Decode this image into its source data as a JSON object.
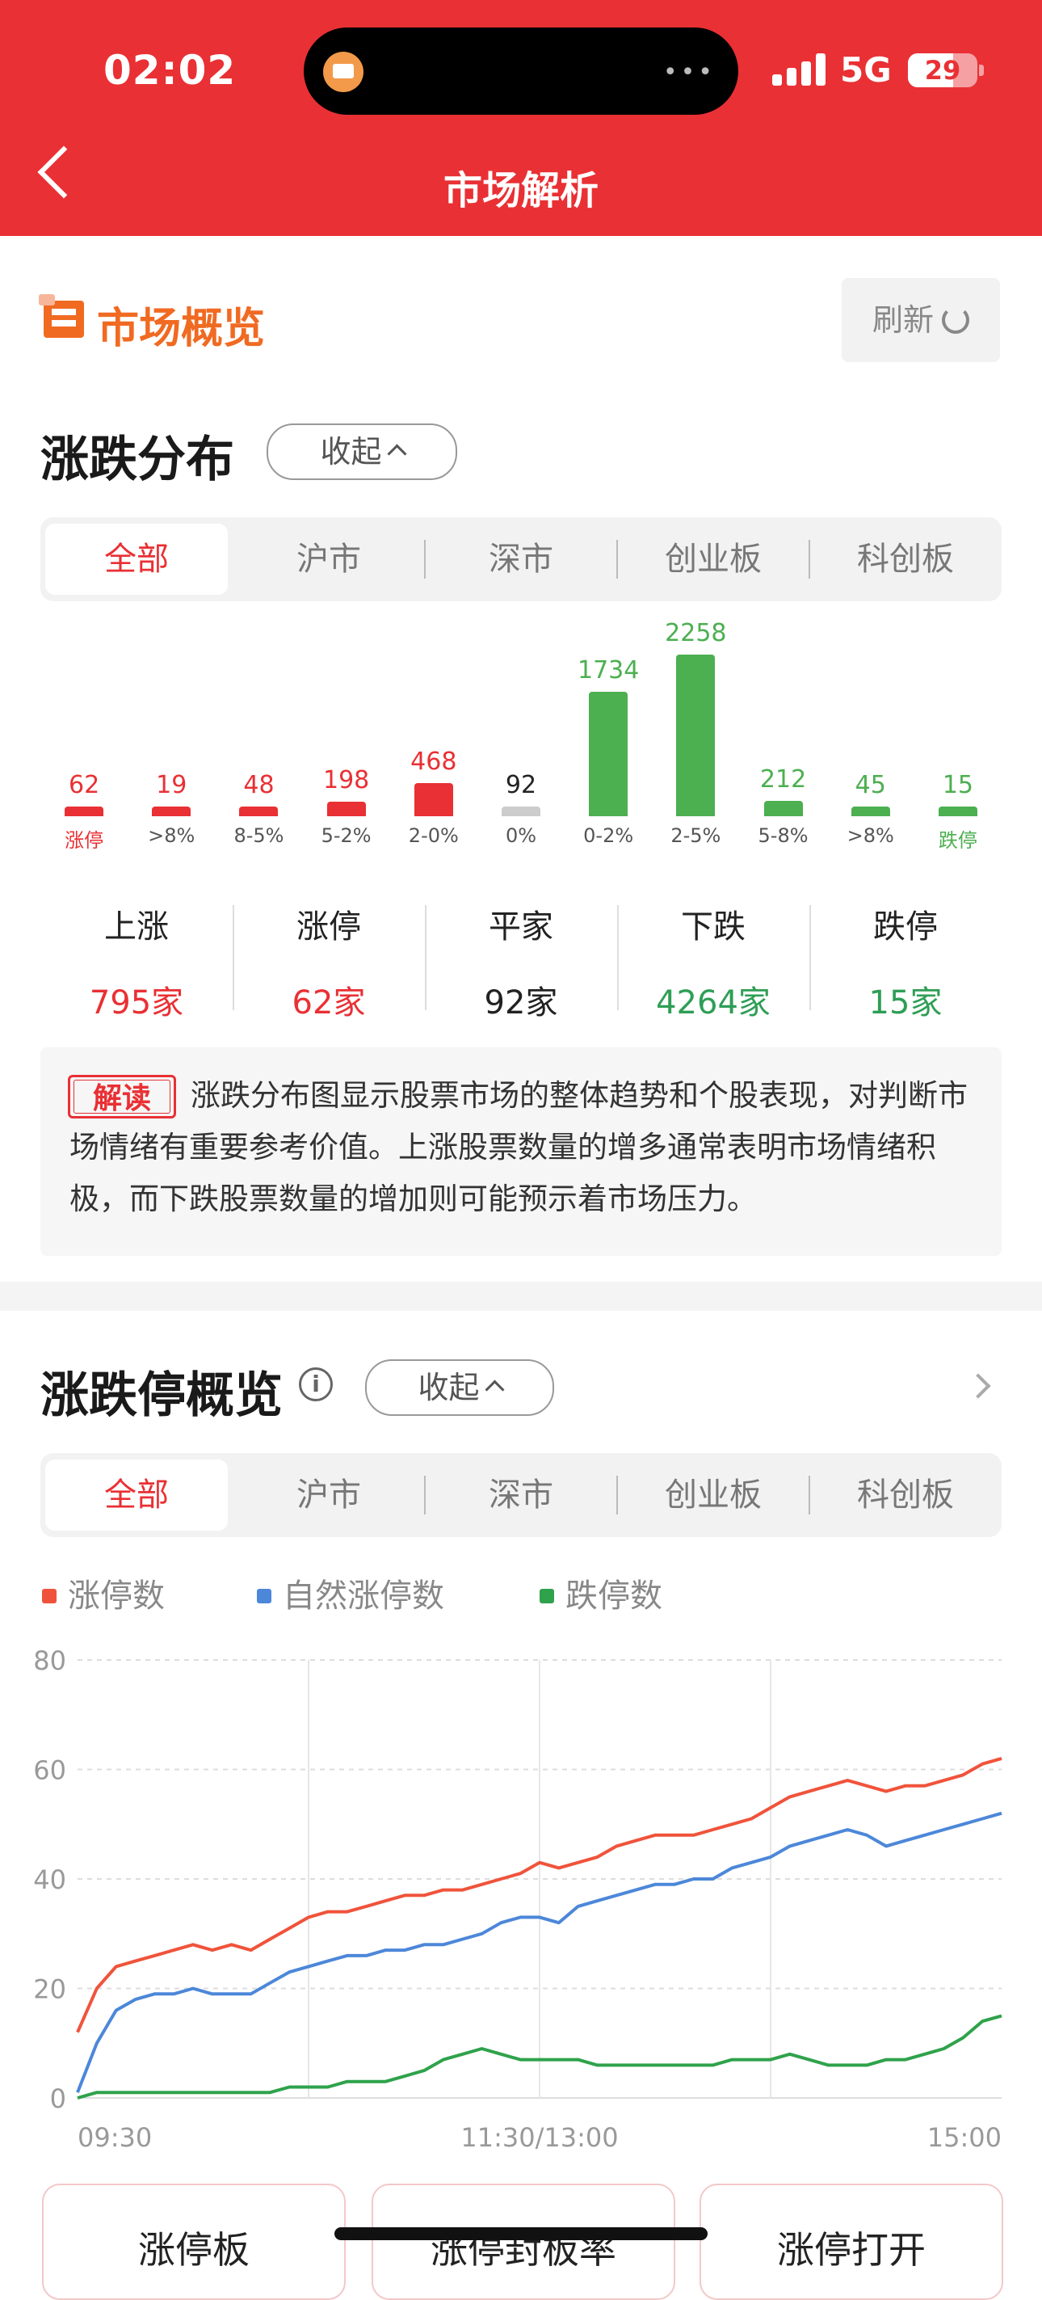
{
  "status_bar": {
    "time": "02:02",
    "network": "5G",
    "battery": "29"
  },
  "header": {
    "title": "市场解析"
  },
  "overview": {
    "title": "市场概览",
    "refresh_label": "刷新"
  },
  "distribution": {
    "title": "涨跌分布",
    "collapse_label": "收起",
    "tabs": [
      "全部",
      "沪市",
      "深市",
      "创业板",
      "科创板"
    ],
    "active_tab": 0,
    "chart_data": {
      "type": "bar",
      "categories": [
        "涨停",
        ">8%",
        "8-5%",
        "5-2%",
        "2-0%",
        "0%",
        "0-2%",
        "2-5%",
        "5-8%",
        ">8%",
        "跌停"
      ],
      "values": [
        62,
        19,
        48,
        198,
        468,
        92,
        1734,
        2258,
        212,
        45,
        15
      ],
      "colors": [
        "#E93034",
        "#E93034",
        "#E93034",
        "#E93034",
        "#E93034",
        "#CCCCCC",
        "#4CAF50",
        "#4CAF50",
        "#4CAF50",
        "#4CAF50",
        "#4CAF50"
      ]
    },
    "stats": [
      {
        "label": "上涨",
        "value": "795家",
        "color": "#E93034"
      },
      {
        "label": "涨停",
        "value": "62家",
        "color": "#E93034"
      },
      {
        "label": "平家",
        "value": "92家",
        "color": "#222222"
      },
      {
        "label": "下跌",
        "value": "4264家",
        "color": "#2E9E55"
      },
      {
        "label": "跌停",
        "value": "15家",
        "color": "#2E9E55"
      }
    ],
    "note_tag": "解读",
    "note_text": "涨跌分布图显示股票市场的整体趋势和个股表现，对判断市场情绪有重要参考价值。上涨股票数量的增多通常表明市场情绪积极，而下跌股票数量的增加则可能预示着市场压力。"
  },
  "limit_overview": {
    "title": "涨跌停概览",
    "collapse_label": "收起",
    "tabs": [
      "全部",
      "沪市",
      "深市",
      "创业板",
      "科创板"
    ],
    "active_tab": 0,
    "legend": [
      "涨停数",
      "自然涨停数",
      "跌停数"
    ],
    "chart_data": {
      "type": "line",
      "x_labels": [
        "09:30",
        "11:30/13:00",
        "15:00"
      ],
      "ylim": [
        0,
        80
      ],
      "y_ticks": [
        80,
        60,
        40,
        20,
        0
      ],
      "grid": true,
      "series": [
        {
          "name": "涨停数",
          "color": "#F0533B",
          "values": [
            12,
            20,
            24,
            25,
            26,
            27,
            28,
            27,
            28,
            27,
            29,
            31,
            33,
            34,
            34,
            35,
            36,
            37,
            37,
            38,
            38,
            39,
            40,
            41,
            43,
            42,
            43,
            44,
            46,
            47,
            48,
            48,
            48,
            49,
            50,
            51,
            53,
            55,
            56,
            57,
            58,
            57,
            56,
            57,
            57,
            58,
            59,
            61,
            62
          ]
        },
        {
          "name": "自然涨停数",
          "color": "#4C87D9",
          "values": [
            1,
            10,
            16,
            18,
            19,
            19,
            20,
            19,
            19,
            19,
            21,
            23,
            24,
            25,
            26,
            26,
            27,
            27,
            28,
            28,
            29,
            30,
            32,
            33,
            33,
            32,
            35,
            36,
            37,
            38,
            39,
            39,
            40,
            40,
            42,
            43,
            44,
            46,
            47,
            48,
            49,
            48,
            46,
            47,
            48,
            49,
            50,
            51,
            52
          ]
        },
        {
          "name": "跌停数",
          "color": "#2FA24B",
          "values": [
            0,
            1,
            1,
            1,
            1,
            1,
            1,
            1,
            1,
            1,
            1,
            2,
            2,
            2,
            3,
            3,
            3,
            4,
            5,
            7,
            8,
            9,
            8,
            7,
            7,
            7,
            7,
            6,
            6,
            6,
            6,
            6,
            6,
            6,
            7,
            7,
            7,
            8,
            7,
            6,
            6,
            6,
            7,
            7,
            8,
            9,
            11,
            14,
            15
          ]
        }
      ]
    },
    "bottom_cards": [
      "涨停板",
      "涨停封板率",
      "涨停打开"
    ]
  },
  "colors": {
    "brand_red": "#E93034",
    "up": "#E93034",
    "down": "#2E9E55",
    "accent_orange": "#F06A22"
  }
}
